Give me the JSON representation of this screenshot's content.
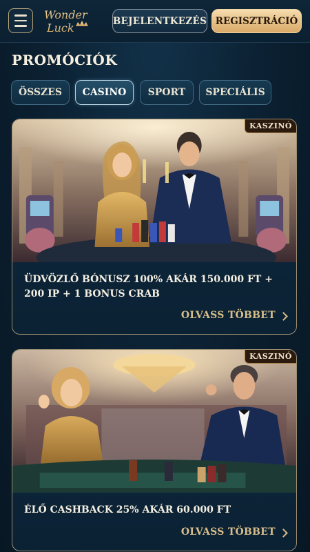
{
  "header": {
    "logo_line1": "Wonder",
    "logo_line2": "Luck",
    "login_label": "BEJELENTKEZÉS",
    "register_label": "REGISZTRÁCIÓ"
  },
  "page": {
    "title": "PROMÓCIÓK"
  },
  "tabs": [
    {
      "label": "ÖSSZES",
      "active": false
    },
    {
      "label": "CASINO",
      "active": true
    },
    {
      "label": "SPORT",
      "active": false
    },
    {
      "label": "SPECIÁLIS",
      "active": false
    }
  ],
  "promotions": [
    {
      "badge": "KASZINÓ",
      "title": "ÜDVÖZLŐ BÓNUSZ 100% AKÁR 150.000 FT + 200 IP + 1 BONUS CRAB",
      "cta": "OLVASS TÖBBET",
      "image": "casino-couple-poker-chips"
    },
    {
      "badge": "KASZINÓ",
      "title": "ÉLŐ CASHBACK 25% AKÁR 60.000 FT",
      "cta": "OLVASS TÖBBET",
      "image": "casino-couple-roulette-table"
    }
  ],
  "colors": {
    "background": "#0b1f30",
    "accent_gold": "#d9bf8a",
    "register_bg": "#e8c288",
    "card_border": "#9c8f72"
  },
  "icons": [
    "menu-icon",
    "chevron-right-icon",
    "crown-icon"
  ]
}
